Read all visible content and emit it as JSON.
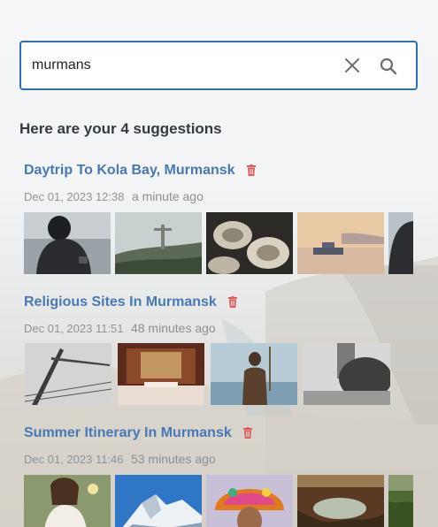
{
  "search": {
    "value": "murmans",
    "clear_icon": "close-icon",
    "search_icon": "search-icon"
  },
  "results": {
    "heading": "Here are your 4 suggestions"
  },
  "colors": {
    "accent": "#2f6fb6",
    "title": "#4a78b5",
    "delete": "#e05a5a",
    "muted": "#8e949a"
  },
  "suggestions": [
    {
      "title": "Daytrip To Kola Bay, Murmansk",
      "date": "Dec 01, 2023 12:38",
      "relative": "a minute ago",
      "delete_icon": "trash-icon",
      "photos": [
        "man-with-phone",
        "christ-statue-overlook",
        "oysters-plate",
        "ferry-at-sunset",
        "hooded-figure"
      ]
    },
    {
      "title": "Religious Sites In Murmansk",
      "date": "Dec 01, 2023 11:51",
      "relative": "48 minutes ago",
      "delete_icon": "trash-icon",
      "photos": [
        "construction-crane",
        "church-altar",
        "neptune-statue",
        "tower-and-trees"
      ]
    },
    {
      "title": "Summer Itinerary In Murmansk",
      "date": "Dec 01, 2023 11:46",
      "relative": "53 minutes ago",
      "delete_icon": "trash-icon",
      "photos": [
        "woman-in-flowers",
        "snowy-mountain",
        "festival-headdress",
        "canyon-lake",
        "green-landscape"
      ]
    }
  ]
}
